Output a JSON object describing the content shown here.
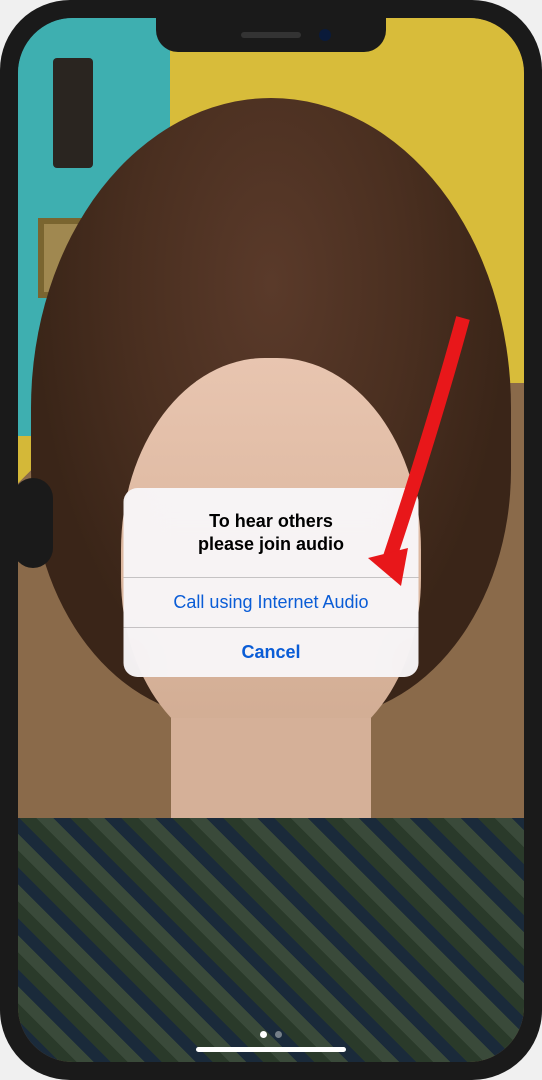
{
  "alert": {
    "title_line1": "To hear others",
    "title_line2": "please join audio",
    "primary_action": "Call using Internet Audio",
    "cancel_action": "Cancel"
  },
  "annotation": {
    "arrow_color": "#e8171a"
  }
}
